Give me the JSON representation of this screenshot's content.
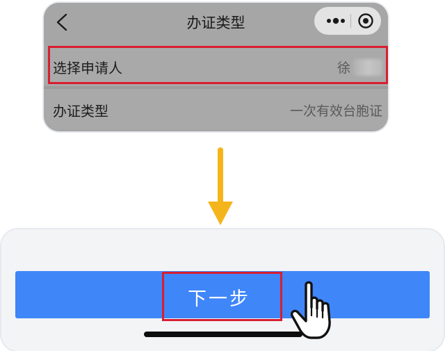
{
  "top_card": {
    "nav_title": "办证类型",
    "rows": [
      {
        "label": "选择申请人",
        "value": "徐"
      },
      {
        "label": "办证类型",
        "value": "一次有效台胞证"
      }
    ],
    "icons": [
      "back-chevron-icon",
      "more-dots-icon",
      "close-target-icon"
    ]
  },
  "arrow": {
    "color": "#f4b51c",
    "direction": "down"
  },
  "bottom_card": {
    "next_label": "下一步",
    "button_color": "#3f86f8",
    "icons": [
      "hand-pointer-icon"
    ]
  },
  "highlight_color": "#d81e2f"
}
